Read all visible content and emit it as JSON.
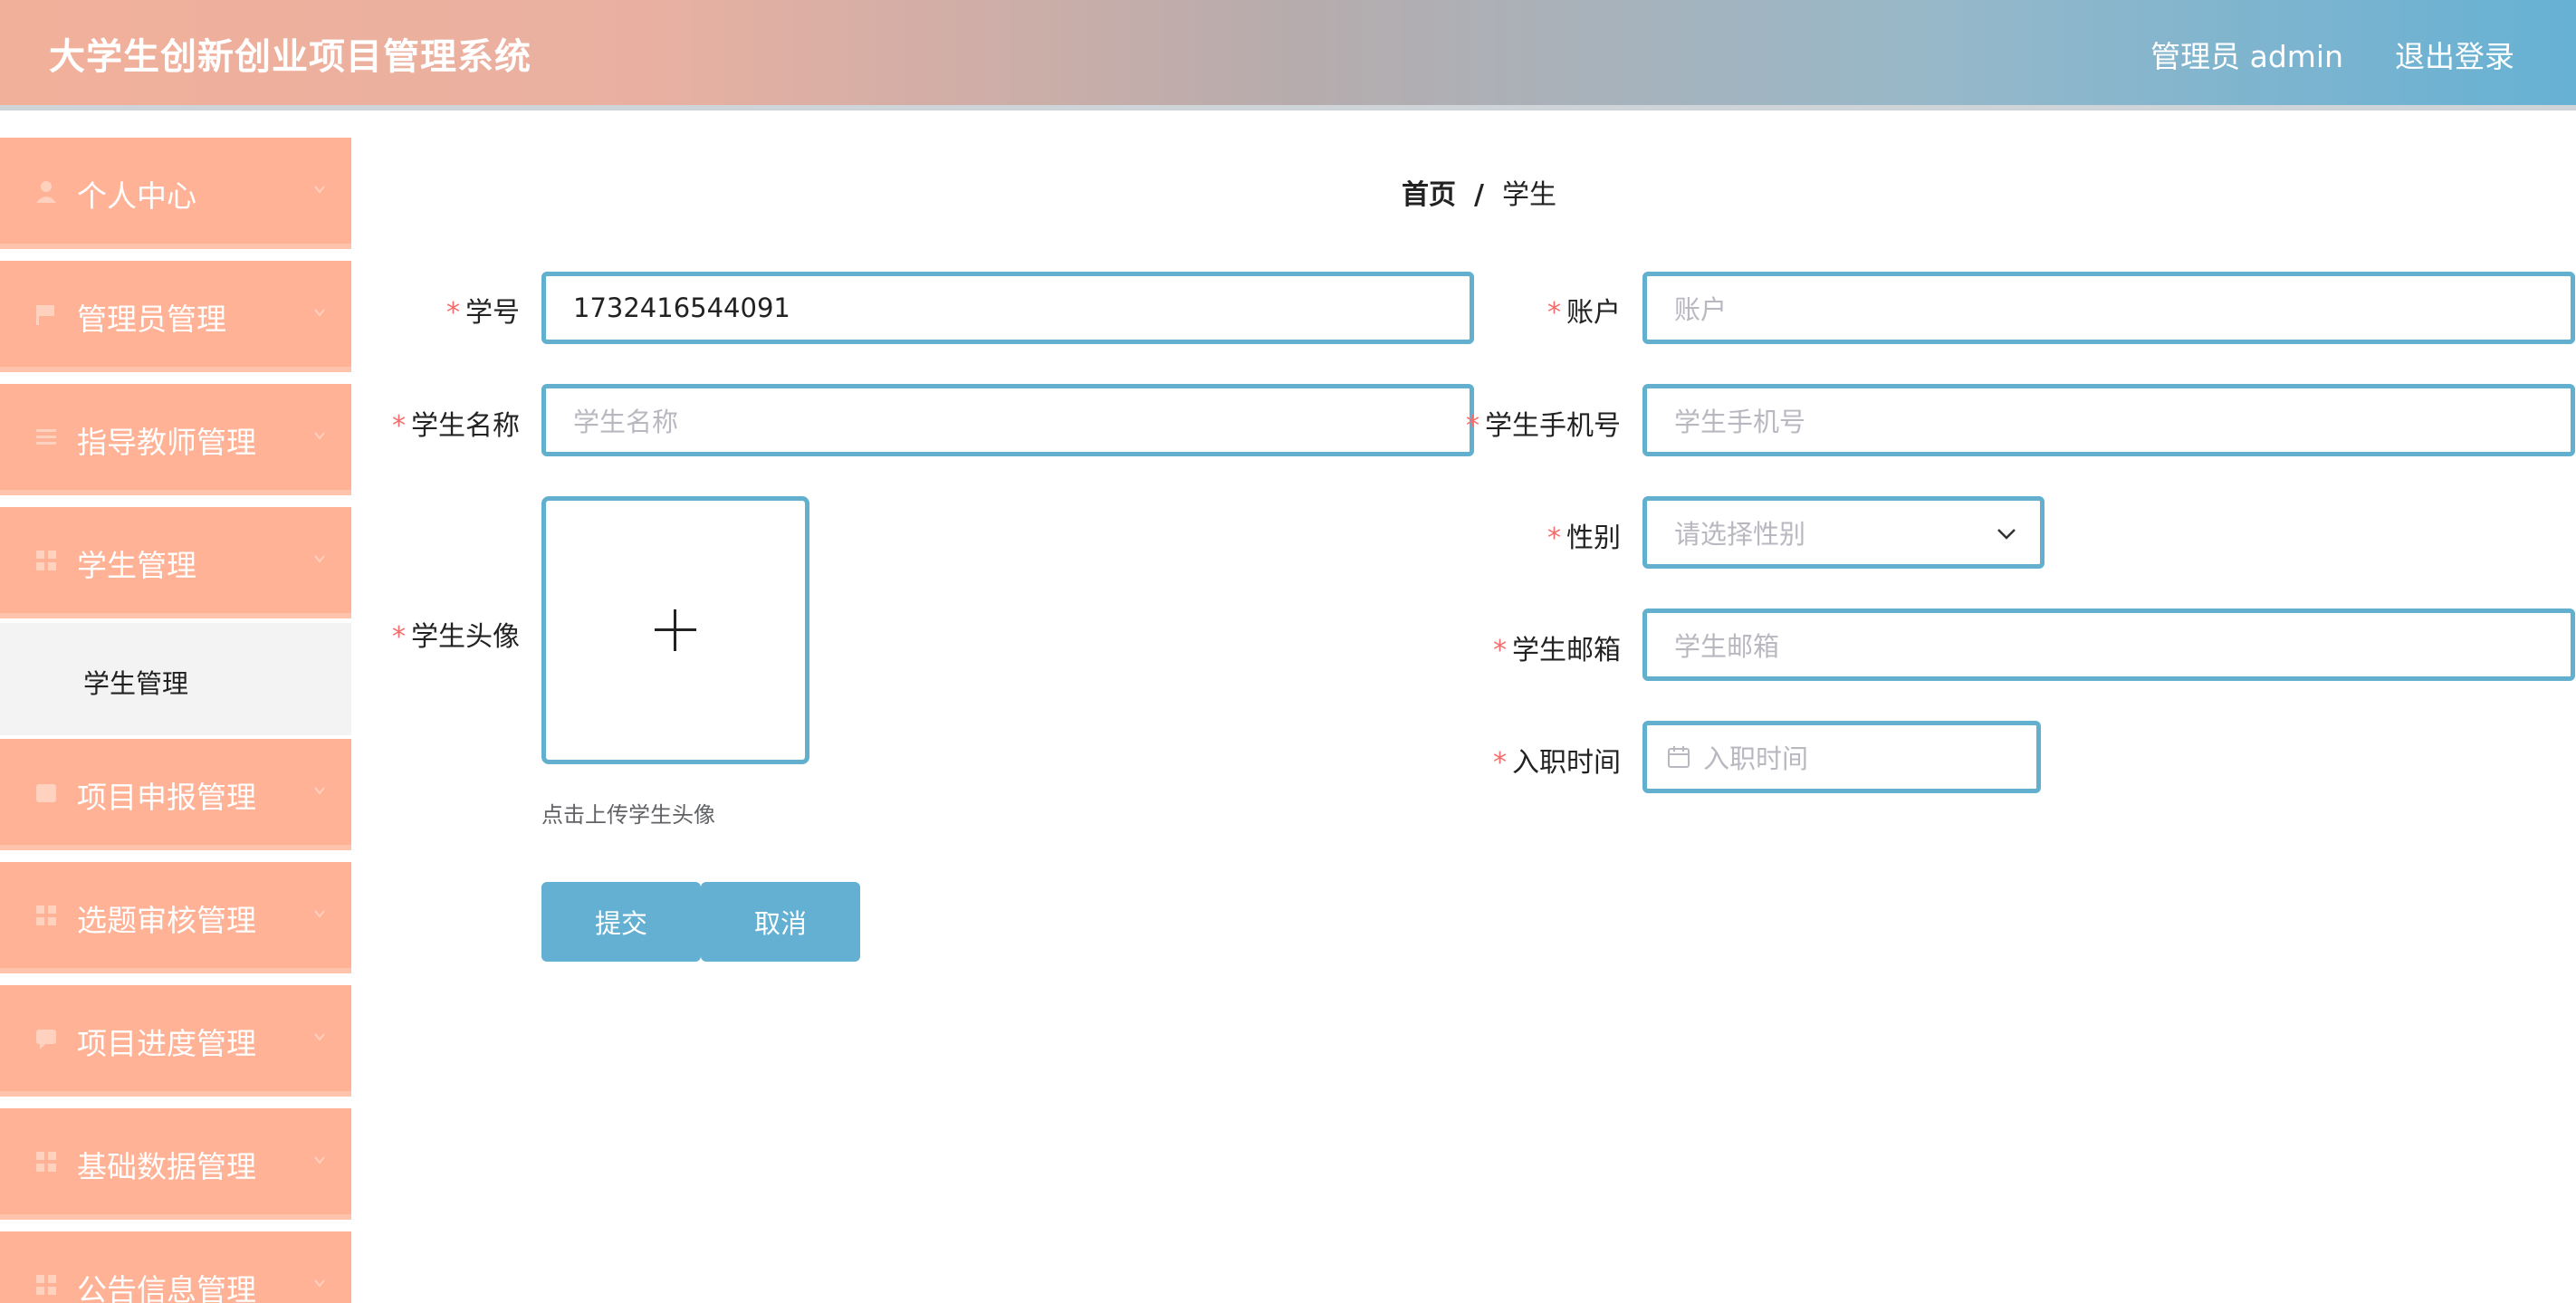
{
  "header": {
    "title": "大学生创新创业项目管理系统",
    "user": "管理员 admin",
    "logout": "退出登录"
  },
  "sidebar": {
    "items": [
      {
        "label": "个人中心",
        "icon": "user-icon"
      },
      {
        "label": "管理员管理",
        "icon": "flag-icon"
      },
      {
        "label": "指导教师管理",
        "icon": "list-icon"
      },
      {
        "label": "学生管理",
        "icon": "grid-icon"
      },
      {
        "label": "项目申报管理",
        "icon": "calendar-icon"
      },
      {
        "label": "选题审核管理",
        "icon": "grid-icon"
      },
      {
        "label": "项目进度管理",
        "icon": "chat-icon"
      },
      {
        "label": "基础数据管理",
        "icon": "grid-icon"
      },
      {
        "label": "公告信息管理",
        "icon": "grid-icon"
      }
    ],
    "submenu": "学生管理"
  },
  "breadcrumb": {
    "home": "首页",
    "separator": "/",
    "current": "学生"
  },
  "form": {
    "student_id": {
      "label": "学号",
      "value": "1732416544091"
    },
    "account": {
      "label": "账户",
      "placeholder": "账户"
    },
    "student_name": {
      "label": "学生名称",
      "placeholder": "学生名称"
    },
    "phone": {
      "label": "学生手机号",
      "placeholder": "学生手机号"
    },
    "avatar": {
      "label": "学生头像",
      "hint": "点击上传学生头像"
    },
    "gender": {
      "label": "性别",
      "placeholder": "请选择性别"
    },
    "email": {
      "label": "学生邮箱",
      "placeholder": "学生邮箱"
    },
    "hire_date": {
      "label": "入职时间",
      "placeholder": "入职时间"
    },
    "required_mark": "*",
    "submit": "提交",
    "cancel": "取消"
  },
  "colors": {
    "menu_bg": "#ffb295",
    "accent": "#63b0ce",
    "required": "#f56c6c"
  }
}
